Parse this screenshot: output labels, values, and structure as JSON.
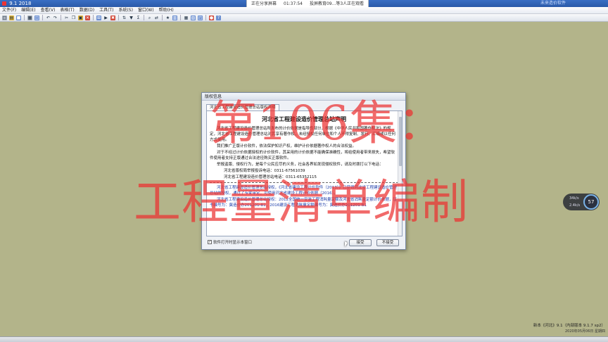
{
  "window": {
    "title": "9.1 2018",
    "right_info": "未来造价软件"
  },
  "share_banner": {
    "status": "正在分享屏幕",
    "time": "01:37:54",
    "viewers": "投屏教育09...等3人正在观看"
  },
  "menu": [
    "文件(F)",
    "编辑(E)",
    "查看(V)",
    "表格(T)",
    "数据(D)",
    "工具(T)",
    "系统(S)",
    "窗口(W)",
    "帮助(H)"
  ],
  "toolbar_icons": [
    {
      "name": "new-file-icon",
      "glyph": "□",
      "color": "gray"
    },
    {
      "name": "open-icon",
      "glyph": "▤",
      "color": "yellow"
    },
    {
      "name": "save-icon",
      "glyph": "■",
      "color": "blue"
    },
    {
      "name": "sep"
    },
    {
      "name": "print-icon",
      "glyph": "▦",
      "color": "gray"
    },
    {
      "name": "preview-icon",
      "glyph": "◫",
      "color": "blue"
    },
    {
      "name": "sep"
    },
    {
      "name": "undo-icon",
      "glyph": "↶",
      "color": ""
    },
    {
      "name": "redo-icon",
      "glyph": "↷",
      "color": ""
    },
    {
      "name": "sep"
    },
    {
      "name": "cut-icon",
      "glyph": "✂",
      "color": ""
    },
    {
      "name": "copy-icon",
      "glyph": "❐",
      "color": ""
    },
    {
      "name": "paste-icon",
      "glyph": "▣",
      "color": "yellow"
    },
    {
      "name": "delete-icon",
      "glyph": "✕",
      "color": "red"
    },
    {
      "name": "sep"
    },
    {
      "name": "insert-row-icon",
      "glyph": "⊞",
      "color": "blue"
    },
    {
      "name": "arrow-right-icon",
      "glyph": "▶",
      "color": ""
    },
    {
      "name": "close-x-icon",
      "glyph": "✖",
      "color": "red"
    },
    {
      "name": "sep"
    },
    {
      "name": "sort-icon",
      "glyph": "⇅",
      "color": ""
    },
    {
      "name": "filter-icon",
      "glyph": "▼",
      "color": ""
    },
    {
      "name": "calc-icon",
      "glyph": "Σ",
      "color": ""
    },
    {
      "name": "sep"
    },
    {
      "name": "search-icon",
      "glyph": "⌕",
      "color": ""
    },
    {
      "name": "replace-icon",
      "glyph": "⇄",
      "color": ""
    },
    {
      "name": "sep"
    },
    {
      "name": "star-icon",
      "glyph": "★",
      "color": ""
    },
    {
      "name": "table-icon",
      "glyph": "▥",
      "color": "blue"
    },
    {
      "name": "sep"
    },
    {
      "name": "grid-icon",
      "glyph": "▦",
      "color": ""
    },
    {
      "name": "layout-icon",
      "glyph": "▧",
      "color": "blue"
    },
    {
      "name": "window-icon",
      "glyph": "◰",
      "color": "blue"
    },
    {
      "name": "sep"
    },
    {
      "name": "user-icon",
      "glyph": "●",
      "color": "red"
    },
    {
      "name": "help-icon",
      "glyph": "?",
      "color": "blue"
    }
  ],
  "dialog": {
    "title": "版权信息",
    "tab": "河北省工程建设造价管理总站版权声明",
    "doc_title": "河北省工程建设造价管理总站声明",
    "paragraphs": [
      "河北省工程建设造价管理总站所发布的计价依据是指导性部分，根据《中华人民共和国著作权法》的规定，河北省工程建设造价管理总站对其享有著作权，未经授权任何单位和个人不得复制、发行、汇编或以任何方式使用。",
      "我们推广正版计价软件，依法保护知识产权，维护计价依据著作权人的合法权益。",
      "对于不经过计价依据授权的计价软件，其采用的计价依据不能确保准确性，将给使用者带来损失，希望软件使用者支持正版通过合法途径购买正版软件。",
      "举报盗版、侵权行为，是每个公民应尽的义务，社会各界如发现侵权软件，请及时拨打以下电话："
    ],
    "contacts": [
      "河北省版权局举报投诉电话：0311-67561039",
      "河北省工程建设造价管理总站电话：0311-65352115"
    ],
    "blue_paragraphs": [
      "河北省工程建设造价管理总站授权，《河北省建设工程计价软件（2013）》已获得河北省工程建设造价管理总站的授权，通过了专家审定，可使用河北省建设工程计价依据（2016）。",
      "河北省工程建设造价管理总站授权：2012全国统一安装工程消耗量定额及河北省消耗量定额计价依据，证书编号为：冀造价办201201-B1，2016建设工程消耗量定额编号为：冀造价办201201-B1"
    ],
    "checkbox_label": "软件打开时显示本窗口",
    "checkbox_checked": "✓",
    "agree_button": "接受",
    "disagree_button": "不接受"
  },
  "overlay": {
    "line1": "第106集：",
    "line2": "工程量清单编制"
  },
  "network_widget": {
    "up": "34k/s",
    "down": "2.4k/s",
    "percent": "57"
  },
  "status": {
    "version": "新本《河北》9.1（内部版本 9.1.7 sp2）",
    "date": "2020年05月06日 星期四"
  }
}
